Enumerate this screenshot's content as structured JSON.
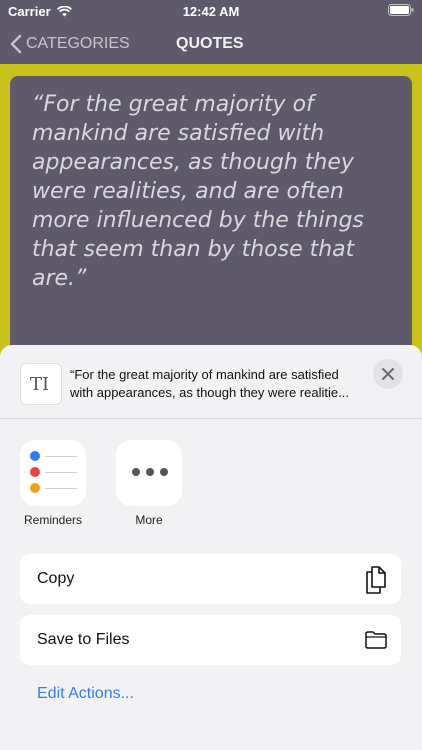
{
  "status_bar": {
    "carrier": "Carrier",
    "time": "12:42 AM"
  },
  "nav": {
    "back_label": "CATEGORIES",
    "title": "QUOTES"
  },
  "quote": {
    "lines": [
      "“For the great majority of",
      "mankind are satisfied with",
      "appearances, as though they",
      "were realities, and are often",
      "more influenced by the things",
      "that seem than by those that",
      "are.”"
    ]
  },
  "share_sheet": {
    "preview_lines": [
      "“For the great majority of mankind are satisfied",
      "with appearances, as though they were realitie..."
    ],
    "apps": [
      {
        "label": "Reminders",
        "icon": "reminders-icon"
      },
      {
        "label": "More",
        "icon": "more-icon"
      }
    ],
    "actions": [
      {
        "label": "Copy",
        "icon": "copy-icon"
      },
      {
        "label": "Save to Files",
        "icon": "folder-icon"
      }
    ],
    "edit_actions_label": "Edit Actions...",
    "colors": {
      "accent": "#2f7cf6",
      "reminder_dots": [
        "#2f7cf6",
        "#e8453c",
        "#f2a01c"
      ]
    }
  }
}
